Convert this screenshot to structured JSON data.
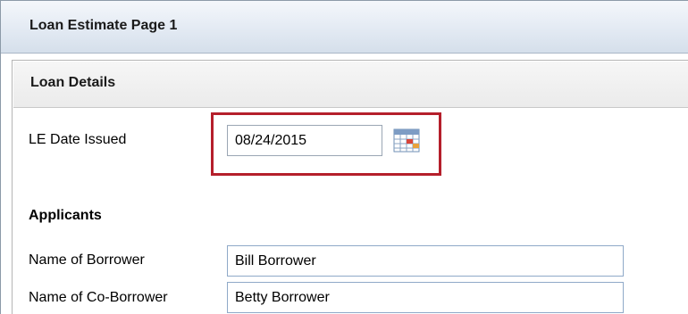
{
  "window": {
    "title": "Loan Estimate Page 1"
  },
  "loan_details": {
    "header": "Loan Details",
    "le_date_issued": {
      "label": "LE Date Issued",
      "value": "08/24/2015",
      "icon": "calendar-icon"
    }
  },
  "applicants": {
    "header": "Applicants",
    "borrower": {
      "label": "Name of Borrower",
      "value": "Bill Borrower"
    },
    "co_borrower": {
      "label": "Name of Co-Borrower",
      "value": "Betty Borrower"
    }
  },
  "colors": {
    "highlight": "#b51f2b",
    "title_bar": "#e3eaf3"
  }
}
